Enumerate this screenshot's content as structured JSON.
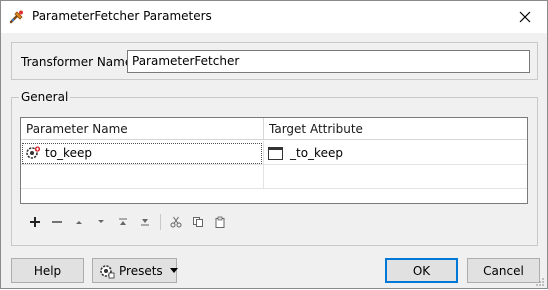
{
  "window": {
    "title": "ParameterFetcher Parameters",
    "icon": "fme-transformer-icon"
  },
  "transformer": {
    "name_label": "Transformer Name:",
    "name_value": "ParameterFetcher"
  },
  "general": {
    "legend": "General",
    "table": {
      "headers": [
        "Parameter Name",
        "Target Attribute"
      ],
      "rows": [
        {
          "parameter": "to_keep",
          "parameter_icon": "published-parameter-icon",
          "attribute": "_to_keep",
          "attribute_icon": "attribute-icon"
        }
      ]
    },
    "toolbar": [
      "add-icon",
      "remove-icon",
      "move-up-icon",
      "move-down-icon",
      "move-to-top-icon",
      "move-to-bottom-icon",
      "cut-icon",
      "copy-icon",
      "paste-icon"
    ]
  },
  "buttons": {
    "help": "Help",
    "presets": "Presets",
    "ok": "OK",
    "cancel": "Cancel"
  },
  "colors": {
    "accent": "#0078d7",
    "dialog_bg": "#f0f0f0"
  }
}
